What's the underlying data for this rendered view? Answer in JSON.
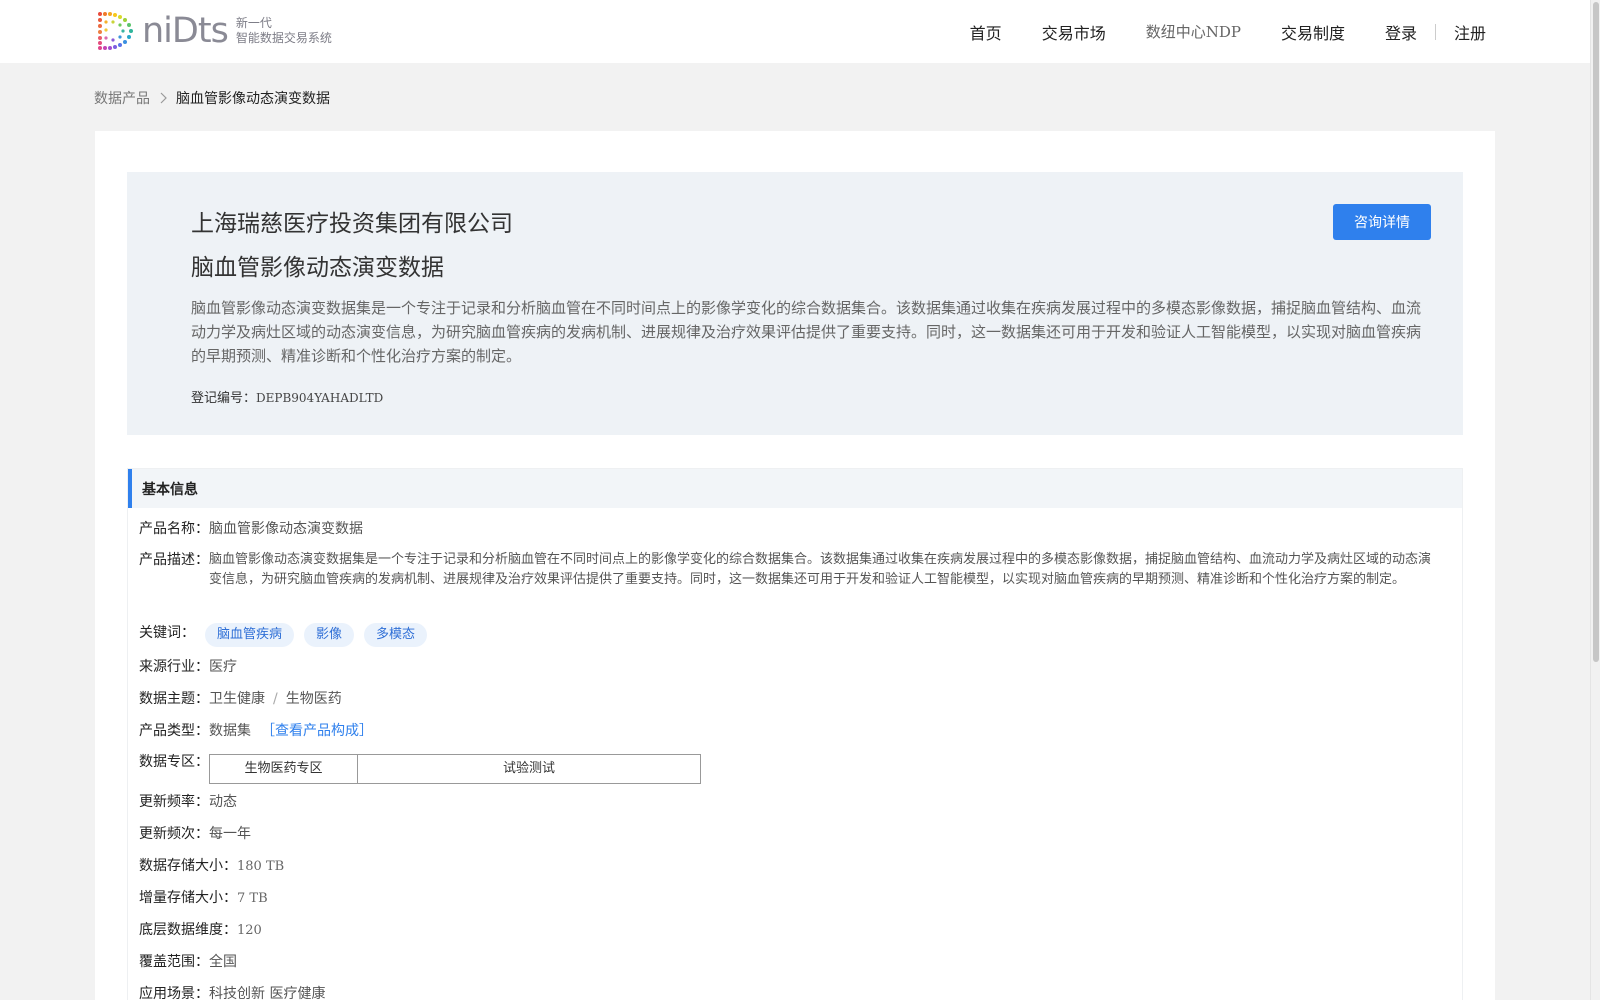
{
  "header": {
    "logo_word": "niDts",
    "logo_sub_1": "新一代",
    "logo_sub_2": "智能数据交易系统",
    "nav": [
      "首页",
      "交易市场",
      "数纽中心NDP",
      "交易制度"
    ],
    "login": "登录",
    "register": "注册"
  },
  "breadcrumb": {
    "root": "数据产品",
    "current": "脑血管影像动态演变数据"
  },
  "hero": {
    "company": "上海瑞慈医疗投资集团有限公司",
    "title": "脑血管影像动态演变数据",
    "description": "脑血管影像动态演变数据集是一个专注于记录和分析脑血管在不同时间点上的影像学变化的综合数据集合。该数据集通过收集在疾病发展过程中的多模态影像数据，捕捉脑血管结构、血流动力学及病灶区域的动态演变信息，为研究脑血管疾病的发病机制、进展规律及治疗效果评估提供了重要支持。同时，这一数据集还可用于开发和验证人工智能模型，以实现对脑血管疾病的早期预测、精准诊断和个性化治疗方案的制定。",
    "reg_label": "登记编号：",
    "reg_value": "DEPB904YAHADLTD",
    "consult_button": "咨询详情"
  },
  "basic": {
    "heading": "基本信息",
    "name_label": "产品名称：",
    "name_value": "脑血管影像动态演变数据",
    "desc_label": "产品描述：",
    "desc_value": "脑血管影像动态演变数据集是一个专注于记录和分析脑血管在不同时间点上的影像学变化的综合数据集合。该数据集通过收集在疾病发展过程中的多模态影像数据，捕捉脑血管结构、血流动力学及病灶区域的动态演变信息，为研究脑血管疾病的发病机制、进展规律及治疗效果评估提供了重要支持。同时，这一数据集还可用于开发和验证人工智能模型，以实现对脑血管疾病的早期预测、精准诊断和个性化治疗方案的制定。",
    "keywords_label": "关键词：",
    "keywords": [
      "脑血管疾病",
      "影像",
      "多模态"
    ],
    "industry_label": "来源行业：",
    "industry_value": "医疗",
    "topic_label": "数据主题：",
    "topic_1": "卫生健康",
    "topic_sep": "/",
    "topic_2": "生物医药",
    "type_label": "产品类型：",
    "type_value": "数据集",
    "type_link": "［查看产品构成］",
    "zone_label": "数据专区：",
    "zone_1": "生物医药专区",
    "zone_2": "试验测试",
    "freq_label": "更新频率：",
    "freq_value": "动态",
    "times_label": "更新频次：",
    "times_value": "每一年",
    "storage_label": "数据存储大小：",
    "storage_value": "180 TB",
    "incr_label": "增量存储大小：",
    "incr_value": "7 TB",
    "dim_label": "底层数据维度：",
    "dim_value": "120",
    "cover_label": "覆盖范围：",
    "cover_value": "全国",
    "scene_label": "应用场景：",
    "scene_value": "科技创新 医疗健康"
  },
  "colors": {
    "accent": "#2f80ed",
    "tag_bg": "#eaf2fc",
    "hero_bg": "#eef2f6"
  }
}
